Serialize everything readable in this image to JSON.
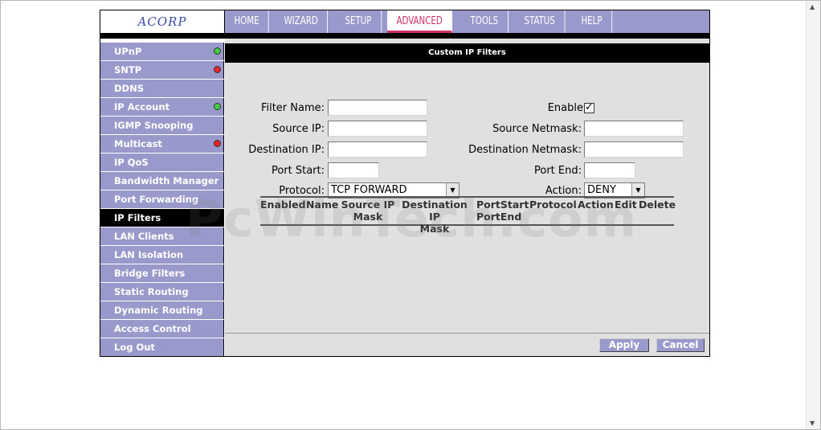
{
  "logo": "ACORP",
  "nav": [
    "HOME",
    "WIZARD",
    "SETUP",
    "ADVANCED",
    "TOOLS",
    "STATUS",
    "HELP"
  ],
  "sidebar": [
    {
      "label": "UPnP",
      "status": "green"
    },
    {
      "label": "SNTP",
      "status": "red"
    },
    {
      "label": "DDNS",
      "status": ""
    },
    {
      "label": "IP Account",
      "status": "green"
    },
    {
      "label": "IGMP Snooping",
      "status": ""
    },
    {
      "label": "Multicast",
      "status": "red"
    },
    {
      "label": "IP QoS",
      "status": ""
    },
    {
      "label": "Bandwidth Manager",
      "status": ""
    },
    {
      "label": "Port Forwarding",
      "status": ""
    },
    {
      "label": "IP Filters",
      "status": ""
    },
    {
      "label": "LAN Clients",
      "status": ""
    },
    {
      "label": "LAN Isolation",
      "status": ""
    },
    {
      "label": "Bridge Filters",
      "status": ""
    },
    {
      "label": "Static Routing",
      "status": ""
    },
    {
      "label": "Dynamic Routing",
      "status": ""
    },
    {
      "label": "Access Control",
      "status": ""
    },
    {
      "label": "Log Out",
      "status": ""
    }
  ],
  "page": {
    "title": "Custom IP Filters"
  },
  "form": {
    "filter_name_label": "Filter Name:",
    "enable_label": "Enable",
    "enable_checked": true,
    "source_ip_label": "Source IP:",
    "source_netmask_label": "Source Netmask:",
    "destination_ip_label": "Destination IP:",
    "destination_netmask_label": "Destination Netmask:",
    "port_start_label": "Port Start:",
    "port_end_label": "Port End:",
    "protocol_label": "Protocol:",
    "protocol_value": "TCP FORWARD",
    "action_label": "Action:",
    "action_value": "DENY",
    "filter_name": "",
    "source_ip": "",
    "source_netmask": "",
    "destination_ip": "",
    "destination_netmask": "",
    "port_start": "",
    "port_end": ""
  },
  "table": {
    "enabled": "Enabled",
    "name": "Name",
    "source_ip": "Source IP",
    "source_ip_2": "Mask",
    "destination_ip": "Destination IP",
    "destination_ip_2": "Mask",
    "portstart": "PortStart",
    "portend": "PortEnd",
    "protocol": "Protocol",
    "action": "Action",
    "edit": "Edit",
    "delete": "Delete"
  },
  "buttons": {
    "apply": "Apply",
    "cancel": "Cancel"
  },
  "watermark": "PcWinTech.com",
  "colors": {
    "nav_bg": "#9999cc",
    "active_accent": "#cc3366",
    "header_bg": "#000000",
    "content_bg": "#e0e0e0"
  }
}
